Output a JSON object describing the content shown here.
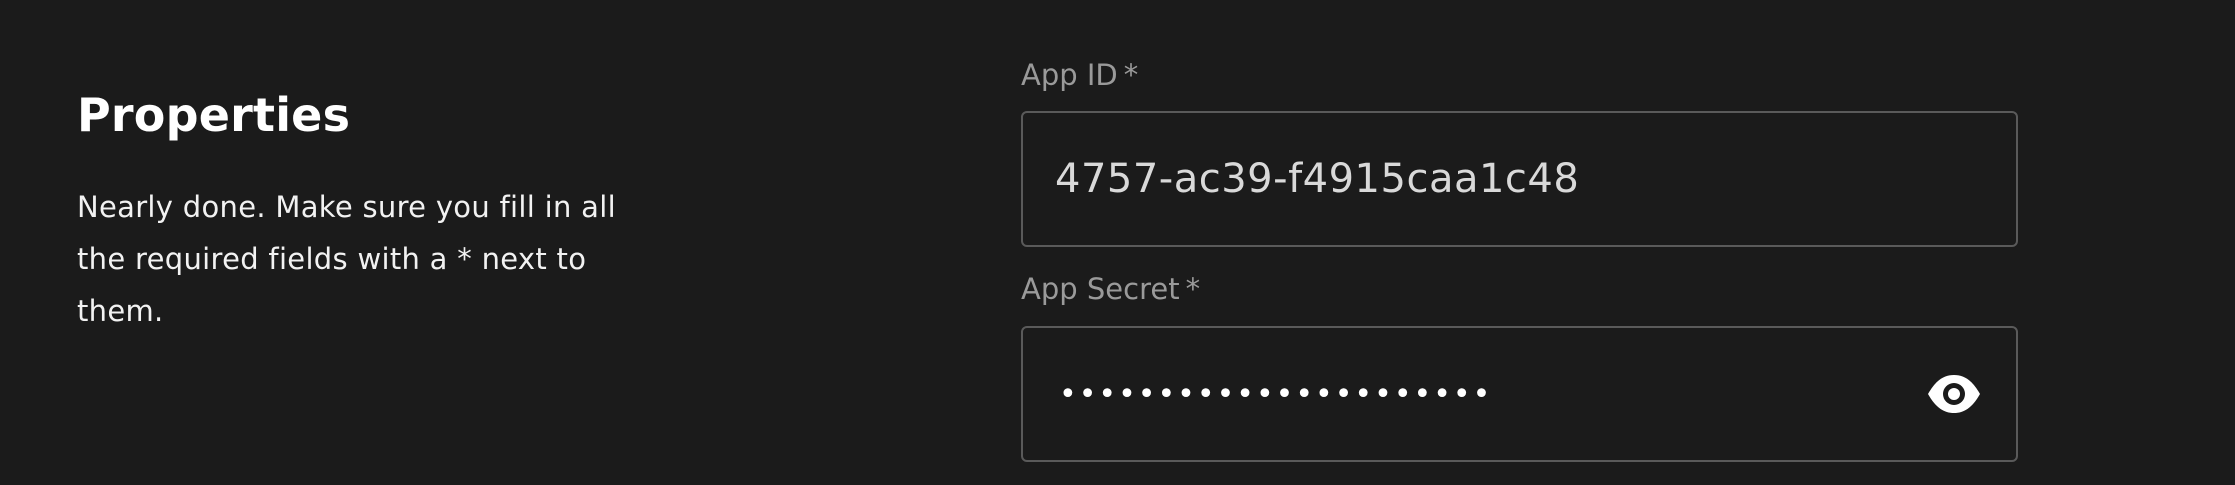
{
  "section": {
    "title": "Properties",
    "description": "Nearly done. Make sure you fill in all the required fields with a * next to them."
  },
  "fields": {
    "app_id": {
      "label": "App ID",
      "required_marker": "*",
      "value": "4757-ac39-f4915caa1c48"
    },
    "app_secret": {
      "label": "App Secret",
      "required_marker": "*",
      "masked_value": "••••••••••••••••••••••",
      "toggle_icon": "eye-icon"
    }
  },
  "colors": {
    "background": "#1b1b1b",
    "label": "#9a9a9a",
    "border": "#5a5a5a",
    "text": "#ffffff"
  }
}
